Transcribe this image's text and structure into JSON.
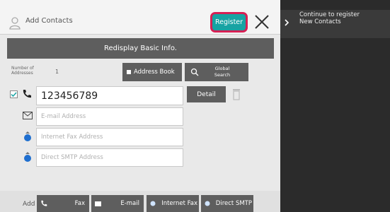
{
  "header": {
    "title": "Add Contacts",
    "register_label": "Register"
  },
  "redisplay_label": "Redisplay Basic Info.",
  "addresses": {
    "count_label_line1": "Number of",
    "count_label_line2": "Addresses",
    "count_value": "1"
  },
  "toolbar": {
    "address_book_label": "Address Book",
    "global_search_line1": "Global",
    "global_search_line2": "Search"
  },
  "fields": {
    "fax_value": "123456789",
    "email_placeholder": "E-mail Address",
    "ifax_placeholder": "Internet Fax Address",
    "smtp_placeholder": "Direct SMTP Address"
  },
  "detail_label": "Detail",
  "footer": {
    "add_label": "Add",
    "fax_label": "Fax",
    "email_label": "E-mail",
    "ifax_label": "Internet Fax",
    "smtp_label": "Direct SMTP"
  },
  "side_panel": {
    "line1": "Continue to register",
    "line2": "New Contacts"
  },
  "colors": {
    "accent": "#17a3a3",
    "highlight": "#d62054",
    "dark_button": "#5e5e5e"
  }
}
